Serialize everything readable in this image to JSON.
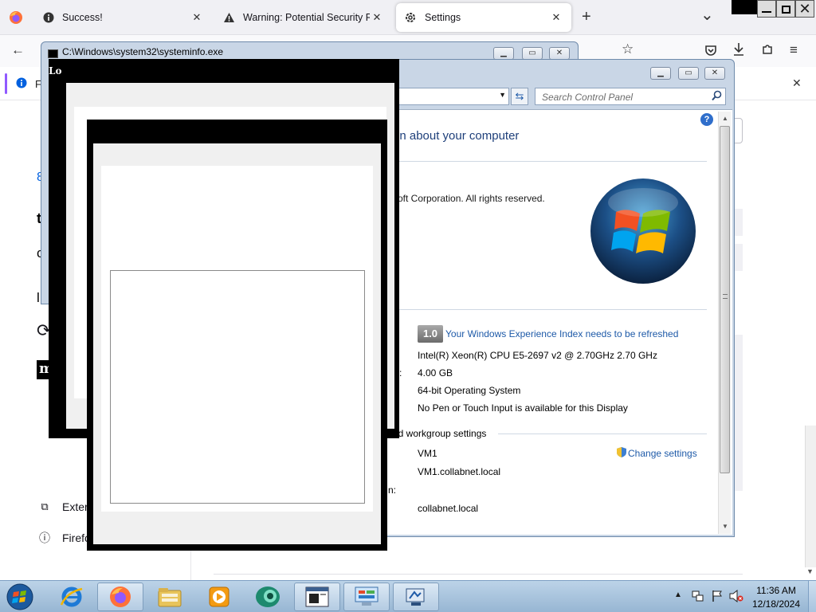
{
  "firefox": {
    "tabs": [
      {
        "label": "Success!",
        "icon": "info-icon"
      },
      {
        "label": "Warning: Potential Security Risk",
        "icon": "warning-icon"
      },
      {
        "label": "Settings",
        "icon": "gear-icon"
      }
    ],
    "new_tab": "+",
    "tab_list": "⌄",
    "close_glyph": "✕",
    "notification_fragment": "F",
    "sidebar_fragments": {
      "extensions": "Exter",
      "support": "Firefo"
    }
  },
  "remote_window": {
    "icon": "remote-desktop-icon"
  },
  "cmd_window": {
    "title": "C:\\Windows\\system32\\systeminfo.exe"
  },
  "black_window": {
    "title_fragment": "Lo"
  },
  "control_panel": {
    "search_placeholder": "Search Control Panel",
    "heading_fragment": "on about your computer",
    "copyright_fragment": "soft Corporation.  All rights reserved.",
    "wei_score": "1.0",
    "wei_link": "Your Windows Experience Index needs to be refreshed",
    "processor": "Intel(R) Xeon(R) CPU E5-2697 v2 @ 2.70GHz   2.70 GHz",
    "ram_label_fragment": ":",
    "ram": "4.00 GB",
    "system_type": "64-bit Operating System",
    "pen_touch": "No Pen or Touch Input is available for this Display",
    "network_section_fragment": "nd workgroup settings",
    "change_settings": "Change settings",
    "computer_name": "VM1",
    "full_computer_name": "VM1.collabnet.local",
    "description_label_fragment": "n:",
    "domain": "collabnet.local"
  },
  "taskbar": {
    "clock_time": "11:36 AM",
    "clock_date": "12/18/2024",
    "icons": [
      "start-orb-icon",
      "ie-icon",
      "firefox-icon",
      "explorer-icon",
      "media-player-icon",
      "app-icon",
      "cmd-icon",
      "control-panel-icon",
      "network-app-icon"
    ]
  },
  "colors": {
    "ff_tabbar": "#f0f0f4",
    "taskbar": "#a9c3de",
    "cp_link": "#1e5aa8",
    "title_bar": "#c9d6e6"
  }
}
